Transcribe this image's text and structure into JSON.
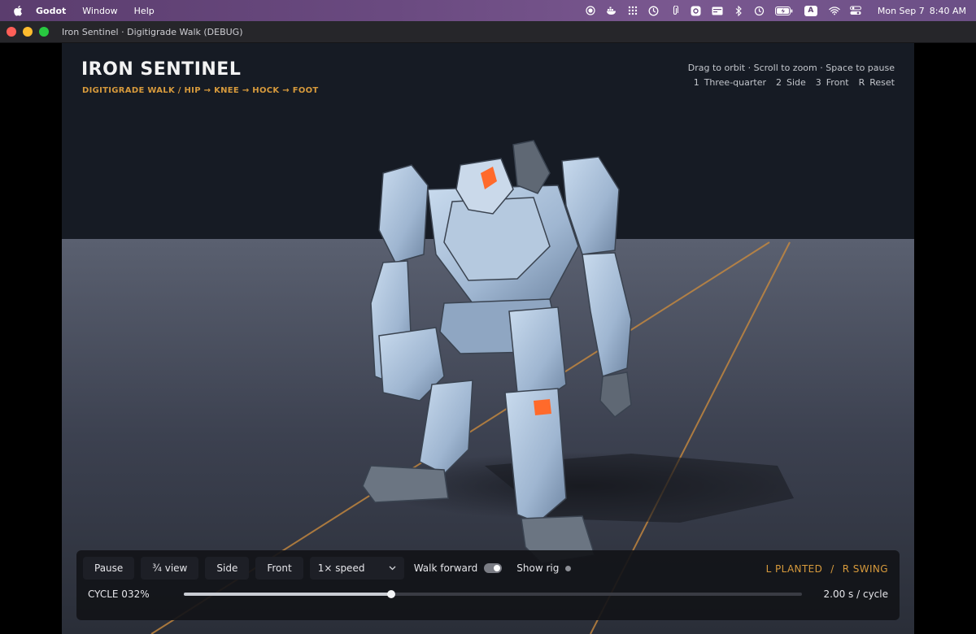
{
  "menubar": {
    "app": "Godot",
    "items": [
      "Window",
      "Help"
    ],
    "status_icons": [
      "record-icon",
      "docker-icon",
      "grid-icon",
      "cloud-icon",
      "paperclip-icon",
      "gear-icon",
      "card-icon",
      "bluetooth-icon",
      "history-icon",
      "battery-icon"
    ],
    "input_source": "A",
    "clock_date": "Mon Sep 7",
    "clock_time": "8:40 AM"
  },
  "window": {
    "title": "Iron Sentinel · Digitigrade Walk (DEBUG)"
  },
  "hud": {
    "title": "IRON SENTINEL",
    "subtitle": "DIGITIGRADE WALK  /  HIP → KNEE → HOCK → FOOT",
    "help": "Drag to orbit · Scroll to zoom · Space to pause",
    "keys": [
      {
        "key": "1",
        "label": "Three-quarter"
      },
      {
        "key": "2",
        "label": "Side"
      },
      {
        "key": "3",
        "label": "Front"
      },
      {
        "key": "R",
        "label": "Reset"
      }
    ]
  },
  "controls": {
    "pause": "Pause",
    "three_quarter": "¾ view",
    "side": "Side",
    "front": "Front",
    "speed": "1× speed",
    "walk_forward": "Walk forward",
    "walk_forward_on": true,
    "show_rig": "Show rig",
    "show_rig_on": false,
    "left_state": "L  PLANTED",
    "separator": "/",
    "right_state": "R  SWING",
    "cycle_label": "CYCLE  032%",
    "cycle_progress": 0.336,
    "rate": "2.00 s / cycle"
  },
  "colors": {
    "accent": "#d79a3c",
    "mech_armor": "#9fb6d1",
    "mech_highlight": "#ff6a2b",
    "floor": "#3c4150",
    "sky": "#161b24"
  }
}
